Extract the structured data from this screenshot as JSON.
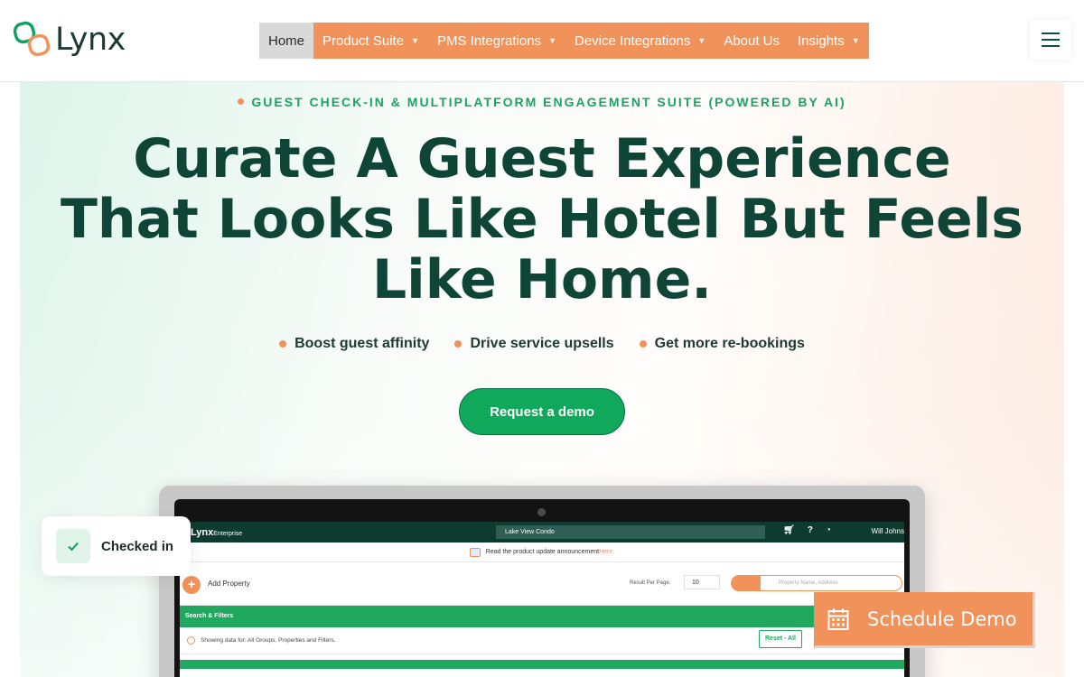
{
  "brand": {
    "name": "Lynx"
  },
  "nav": {
    "items": [
      {
        "label": "Home",
        "active": true,
        "has_dropdown": false
      },
      {
        "label": "Product Suite",
        "has_dropdown": true
      },
      {
        "label": "PMS Integrations",
        "has_dropdown": true
      },
      {
        "label": "Device Integrations",
        "has_dropdown": true
      },
      {
        "label": "About Us",
        "has_dropdown": false
      },
      {
        "label": "Insights",
        "has_dropdown": true
      }
    ],
    "caret": "▼",
    "menu_icon": "hamburger-icon"
  },
  "hero": {
    "eyebrow": "GUEST CHECK-IN & MULTIPLATFORM ENGAGEMENT SUITE (POWERED BY AI)",
    "headline": "Curate A Guest Experience That Looks Like Hotel But Feels Like Home.",
    "bullets": [
      "Boost guest affinity",
      "Drive service upsells",
      "Get more re-bookings"
    ],
    "cta_label": "Request a demo"
  },
  "app_preview": {
    "logo": "Lynx",
    "logo_suffix": "Enterprise",
    "property": "Lake View Condo",
    "icons": [
      "cart-icon",
      "help-icon",
      "support-icon"
    ],
    "user": "Will Johns",
    "announcement": "Read the product update announcement",
    "announcement_link": "Here.",
    "add_property": "Add Property",
    "results_per_page_label": "Result Per Page:",
    "results_per_page_value": "10",
    "search_placeholder": "Property Name, Address",
    "filters_label": "Search & Filters",
    "showing_text": "Showing data for: All Groups, Properties and Filters.",
    "reset_label": "Reset - All"
  },
  "checked_card": {
    "label": "Checked in"
  },
  "schedule": {
    "label": "Schedule Demo"
  },
  "colors": {
    "brand_green": "#10a85a",
    "dark_green": "#0f4536",
    "accent_orange": "#f0925a"
  }
}
